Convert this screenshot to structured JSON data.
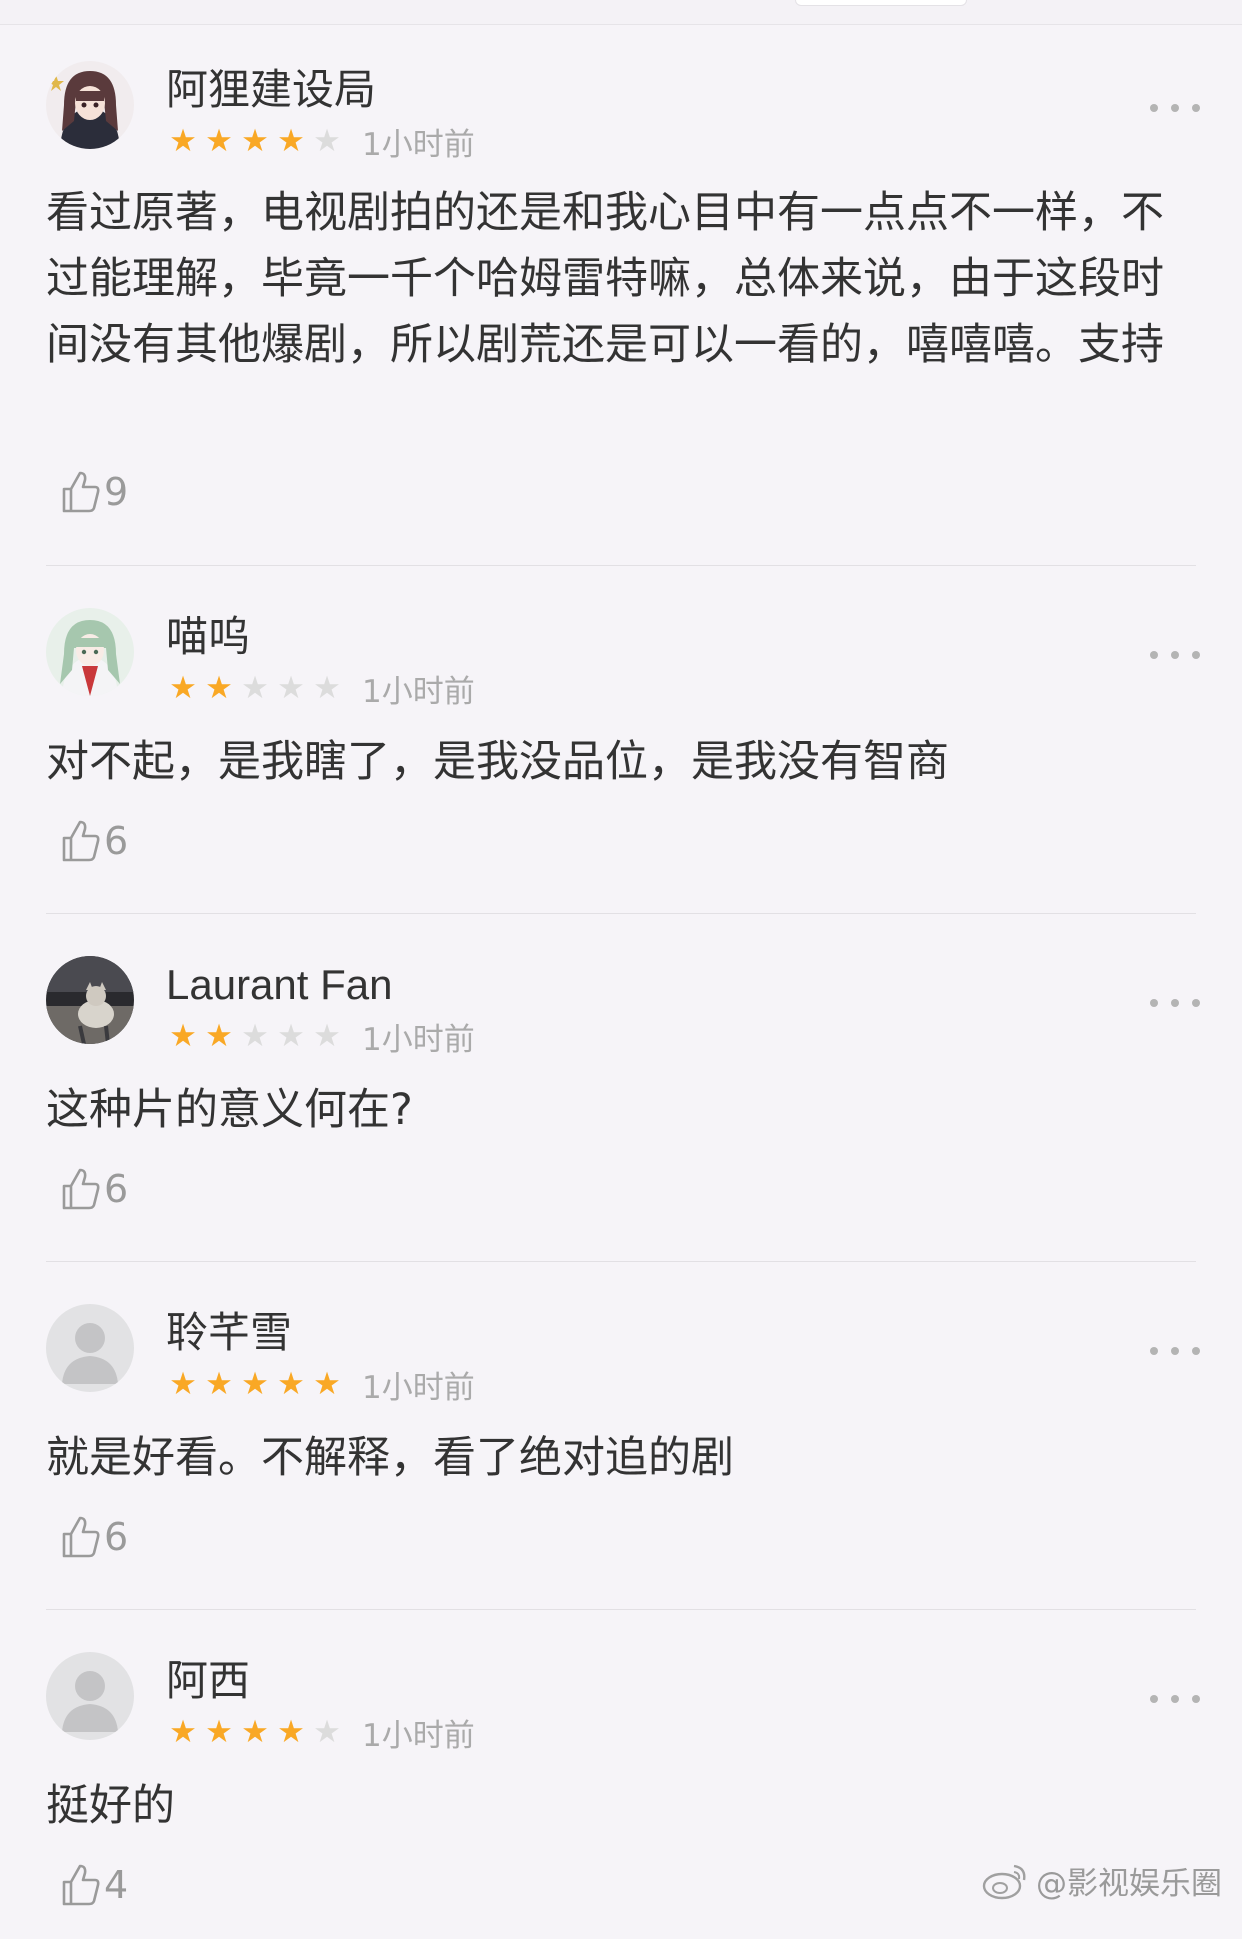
{
  "reviews": [
    {
      "username": "阿狸建设局",
      "rating": 4,
      "time": "1小时前",
      "content": "看过原著，电视剧拍的还是和我心目中有一点点不一样，不过能理解，毕竟一千个哈姆雷特嘛，总体来说，由于这段时间没有其他爆剧，所以剧荒还是可以一看的，嘻嘻嘻。支持",
      "likes": "9"
    },
    {
      "username": "喵呜",
      "rating": 2,
      "time": "1小时前",
      "content": "对不起，是我瞎了，是我没品位，是我没有智商",
      "likes": "6"
    },
    {
      "username": "Laurant  Fan",
      "rating": 2,
      "time": "1小时前",
      "content": "这种片的意义何在?",
      "likes": "6"
    },
    {
      "username": "聆芊雪",
      "rating": 5,
      "time": "1小时前",
      "content": "就是好看。不解释，看了绝对追的剧",
      "likes": "6"
    },
    {
      "username": "阿西",
      "rating": 4,
      "time": "1小时前",
      "content": "挺好的",
      "likes": "4"
    }
  ],
  "watermark": "@影视娱乐圈",
  "colors": {
    "star_on": "#f9a825",
    "star_off": "#dcdcdc",
    "text": "#333333",
    "muted": "#aaaaaa"
  },
  "icons": {
    "like": "thumbs-up-icon",
    "more": "more-dots-icon",
    "watermark": "weibo-logo-icon"
  }
}
